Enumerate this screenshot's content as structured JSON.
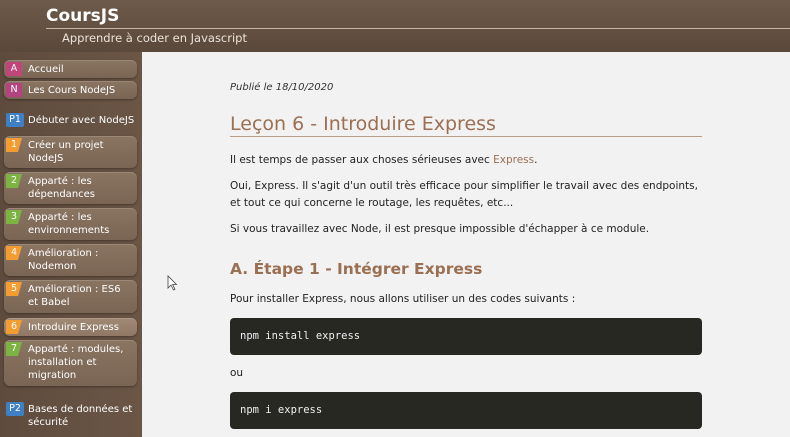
{
  "header": {
    "site_title": "CoursJS",
    "subtitle": "Apprendre à coder en Javascript"
  },
  "sidebar": {
    "top_items": [
      {
        "badge": "A",
        "badge_color": "#c0457a",
        "label": "Accueil"
      },
      {
        "badge": "N",
        "badge_color": "#b2457f",
        "label": "Les Cours NodeJS"
      }
    ],
    "section_p1": {
      "badge": "P1",
      "label": "Débuter avec NodeJS"
    },
    "lessons": [
      {
        "badge": "1",
        "label": "Créer un projet NodeJS"
      },
      {
        "badge": "2",
        "label": "Apparté : les dépendances"
      },
      {
        "badge": "3",
        "label": "Apparté : les environnements"
      },
      {
        "badge": "4",
        "label": "Amélioration : Nodemon"
      },
      {
        "badge": "5",
        "label": "Amélioration : ES6 et Babel"
      },
      {
        "badge": "6",
        "label": "Introduire Express"
      },
      {
        "badge": "7",
        "label": "Apparté : modules, installation et migration"
      }
    ],
    "section_p2": {
      "badge": "P2",
      "label": "Bases de données et sécurité"
    }
  },
  "article": {
    "published": "Publié le 18/10/2020",
    "title": "Leçon 6 - Introduire Express",
    "p1_before": "Il est temps de passer aux choses sérieuses avec ",
    "p1_highlight": "Express",
    "p1_after": ".",
    "p2": "Oui, Express. Il s'agit d'un outil très efficace pour simplifier le travail avec des endpoints, et tout ce qui concerne le routage, les requêtes, etc...",
    "p3": "Si vous travaillez avec Node, il est presque impossible d'échapper à ce module.",
    "section_a_title": "A. Étape 1 - Intégrer Express",
    "p4": "Pour installer Express, nous allons utiliser un des codes suivants :",
    "code1": "npm install express",
    "or_text": "ou",
    "code2": "npm i express"
  },
  "colors": {
    "green_badge": "#7cb342",
    "orange_badge": "#f39c32",
    "section_badge": "#3f7fc4",
    "title_accent": "#9a6f52"
  }
}
